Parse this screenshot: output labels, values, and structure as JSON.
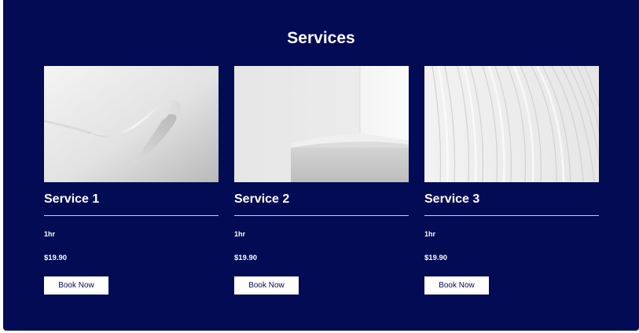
{
  "section": {
    "title": "Services",
    "background_color": "#020b53"
  },
  "services": [
    {
      "title": "Service 1",
      "duration": "1hr",
      "price": "$19.90",
      "button_label": "Book Now",
      "image_icon": "abstract-curved-ribbon-image"
    },
    {
      "title": "Service 2",
      "duration": "1hr",
      "price": "$19.90",
      "button_label": "Book Now",
      "image_icon": "abstract-corner-wall-image"
    },
    {
      "title": "Service 3",
      "duration": "1hr",
      "price": "$19.90",
      "button_label": "Book Now",
      "image_icon": "abstract-curved-lines-image"
    }
  ]
}
